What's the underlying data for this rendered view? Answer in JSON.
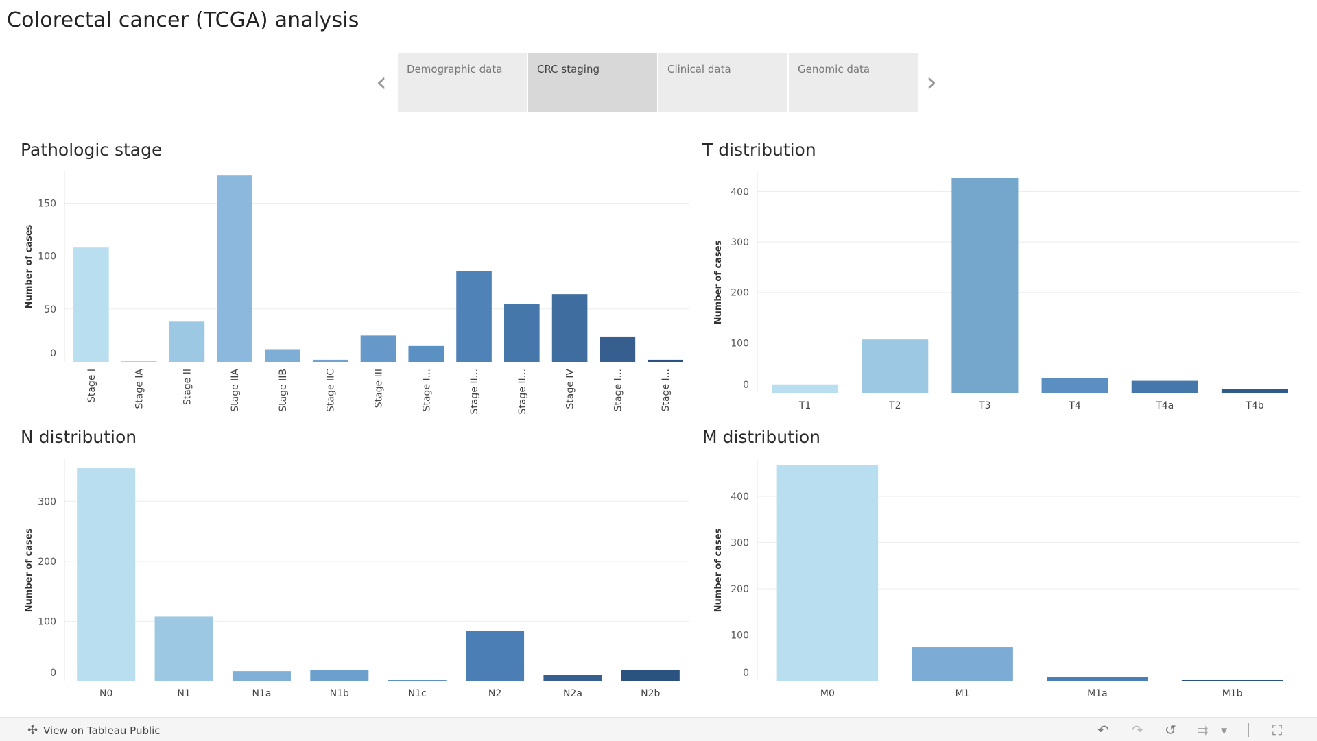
{
  "page": {
    "title": "Colorectal cancer (TCGA) analysis"
  },
  "tabs": [
    {
      "label": "Demographic data",
      "active": false
    },
    {
      "label": "CRC staging",
      "active": true
    },
    {
      "label": "Clinical data",
      "active": false
    },
    {
      "label": "Genomic data",
      "active": false
    }
  ],
  "footer": {
    "view_label": "View on Tableau Public"
  },
  "chart_data": [
    {
      "type": "bar",
      "title": "Pathologic stage",
      "xlabel": "",
      "ylabel": "Number of cases",
      "ylim": [
        0,
        180
      ],
      "yticks": [
        0,
        50,
        100,
        150
      ],
      "grid": true,
      "categories": [
        "Stage I",
        "Stage IA",
        "Stage II",
        "Stage IIA",
        "Stage IIB",
        "Stage IIC",
        "Stage III",
        "Stage I...",
        "Stage II...",
        "Stage II...",
        "Stage IV",
        "Stage I...",
        "Stage I..."
      ],
      "values": [
        108,
        1,
        38,
        176,
        12,
        2,
        25,
        15,
        86,
        55,
        64,
        24,
        2
      ],
      "colors": [
        "#b9def0",
        "#a9d2eb",
        "#9dc8e4",
        "#8bb8dc",
        "#7eadd6",
        "#72a3cf",
        "#6699c9",
        "#5b90c3",
        "#4f83b8",
        "#4677ab",
        "#3f6d9f",
        "#365f8f",
        "#2b5281"
      ]
    },
    {
      "type": "bar",
      "title": "T distribution",
      "xlabel": "",
      "ylabel": "Number of cases",
      "ylim": [
        0,
        440
      ],
      "yticks": [
        0,
        100,
        200,
        300,
        400
      ],
      "grid": true,
      "categories": [
        "T1",
        "T2",
        "T3",
        "T4",
        "T4a",
        "T4b"
      ],
      "values": [
        18,
        107,
        427,
        31,
        25,
        9
      ],
      "colors": [
        "#b9def0",
        "#9dc8e4",
        "#75a7cd",
        "#5b8fc2",
        "#4677ab",
        "#2f5a89"
      ]
    },
    {
      "type": "bar",
      "title": "N distribution",
      "xlabel": "",
      "ylabel": "Number of cases",
      "ylim": [
        0,
        370
      ],
      "yticks": [
        0,
        100,
        200,
        300
      ],
      "grid": true,
      "categories": [
        "N0",
        "N1",
        "N1a",
        "N1b",
        "N1c",
        "N2",
        "N2a",
        "N2b"
      ],
      "values": [
        355,
        108,
        17,
        19,
        2,
        84,
        11,
        19
      ],
      "colors": [
        "#b9def0",
        "#9dc8e4",
        "#80afd7",
        "#6d9fcd",
        "#5d91c4",
        "#4a7eb4",
        "#365f8f",
        "#2b5281"
      ]
    },
    {
      "type": "bar",
      "title": "M distribution",
      "xlabel": "",
      "ylabel": "Number of cases",
      "ylim": [
        0,
        480
      ],
      "yticks": [
        0,
        100,
        200,
        300,
        400
      ],
      "grid": true,
      "categories": [
        "M0",
        "M1",
        "M1a",
        "M1b"
      ],
      "values": [
        467,
        74,
        10,
        3
      ],
      "colors": [
        "#b9def0",
        "#7cabd5",
        "#4a7eb4",
        "#2b5281"
      ]
    }
  ]
}
